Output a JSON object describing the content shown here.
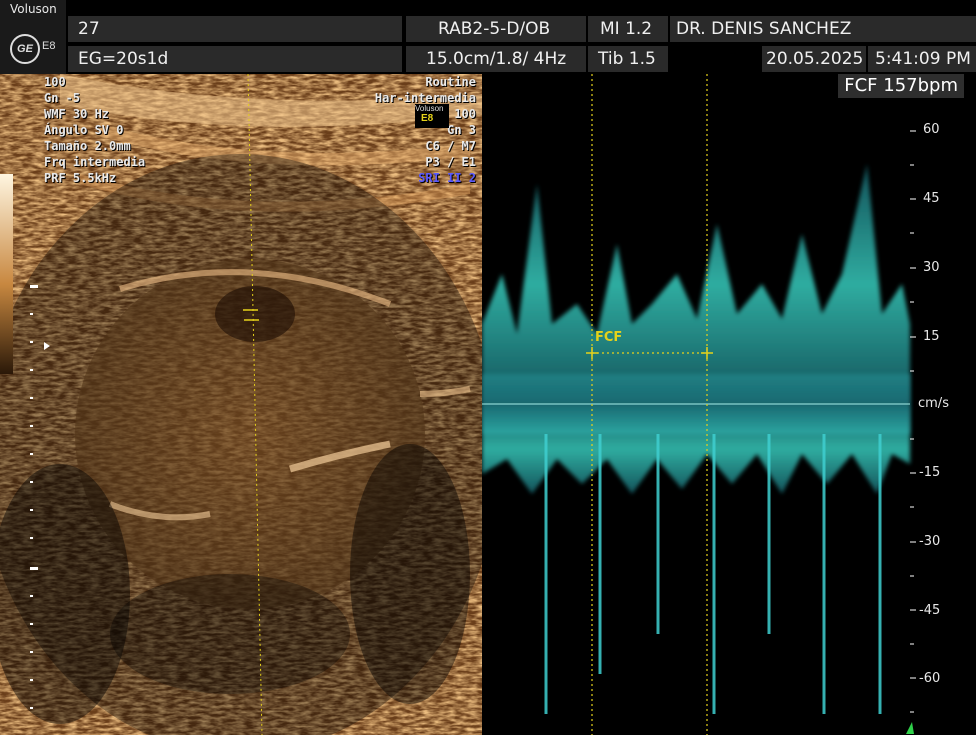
{
  "header": {
    "brand": "Voluson",
    "logo_text": "GE",
    "model": "E8",
    "patient_id": "27",
    "gestational_age": "EG=20s1d",
    "probe": "RAB2-5-D/OB",
    "depth_info": "15.0cm/1.8/ 4Hz",
    "mi": "MI  1.2",
    "tib": "Tib  1.5",
    "doctor": "DR. DENIS SANCHEZ",
    "date": "20.05.2025",
    "time": "5:41:09 PM"
  },
  "bmode_params_left": [
    "100",
    "Gn  -5",
    "WMF 30 Hz",
    "Ángulo SV  0",
    "Tamaño  2.0mm",
    "Frq intermedia",
    "PRF  5.5kHz"
  ],
  "bmode_params_right": [
    "Routine",
    "Har-intermedia",
    "100",
    "Gn  3",
    "C6 / M7",
    "P3 / E1",
    "SRI II 2"
  ],
  "mini_logo": {
    "brand": "Voluson",
    "model": "E8"
  },
  "doppler": {
    "fcf_readout": "FCF 157bpm",
    "fcf_marker_label": "FCF",
    "unit": "cm/s",
    "scale_ticks": [
      "60",
      "45",
      "30",
      "15",
      "-15",
      "-30",
      "-45",
      "-60"
    ]
  },
  "colors": {
    "doppler_spectrum": "#3fe6d6",
    "marker": "#e6d21a",
    "tissue": "#c8823c",
    "header_cell": "#2a2a2a"
  }
}
